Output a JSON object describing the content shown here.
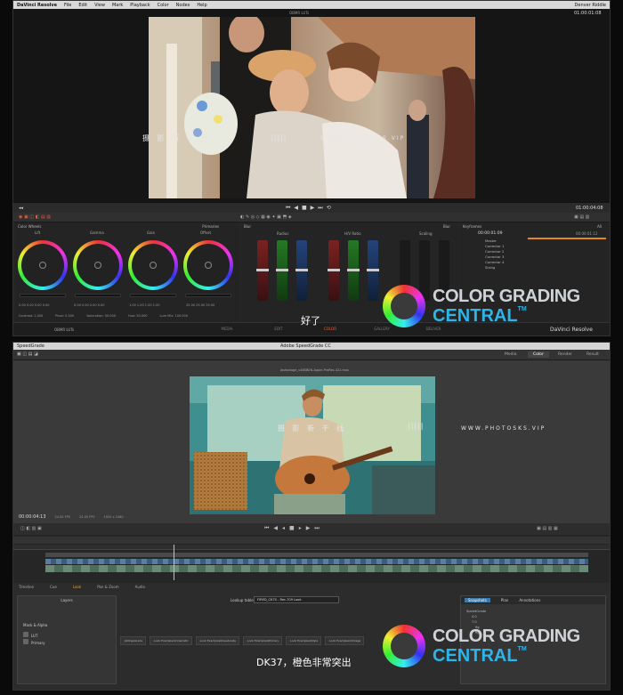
{
  "davinci": {
    "app_name": "DaVinci Resolve",
    "menu": [
      "File",
      "Edit",
      "View",
      "Mark",
      "Playback",
      "Color",
      "Nodes",
      "Help"
    ],
    "user": "Denver Riddle",
    "viewer_title": "OBMR LUTs",
    "timecode_top": "01:00:01:08",
    "timecode_ctrl": "01:00:04:08",
    "wheels_header": "Color Wheels",
    "wheels_mode": "Primaries",
    "wheels": [
      {
        "label": "Lift",
        "vals": "0.00  0.00  0.00  0.00"
      },
      {
        "label": "Gamma",
        "vals": "0.00  0.00  0.00  0.00"
      },
      {
        "label": "Gain",
        "vals": "1.00  1.00  1.00  1.00"
      },
      {
        "label": "Offset",
        "vals": "25.00  25.00  25.00"
      }
    ],
    "wheels_footer": [
      "Contrast: 1.000",
      "Pivot: 0.500",
      "Saturation: 50.000",
      "Hue: 50.000",
      "Lum Mix: 100.000"
    ],
    "curves_sections": [
      "Blur",
      "Radius",
      "H/V Ratio",
      "Scaling"
    ],
    "curves_color": "Blur",
    "nodes_header": "Keyframes",
    "nodes_filter": "All",
    "nodes_timecode": "00:00:01:09",
    "nodes_timecode_right": "00:00:01:12",
    "nodes_list": [
      "Master",
      "Corrector 1",
      "Corrector 2",
      "Corrector 3",
      "Corrector 4",
      "Sizing"
    ],
    "bottom_clip": "OBMR LUTs",
    "bottom_nav": [
      "MEDIA",
      "EDIT",
      "COLOR",
      "GALLERY",
      "DELIVER"
    ],
    "bottom_active": "COLOR",
    "subtitle": "好了"
  },
  "speedgrade": {
    "app_name": "SpeedGrade",
    "title": "Adobe SpeedGrade CC",
    "tabs": [
      "Media",
      "Color",
      "Render",
      "Result"
    ],
    "active_tab": "Color",
    "file_name": "jbsfootage_v4BSBEN-Apple-ProRes-422.mov",
    "timecode": "00:00:04:13",
    "fps": "24.00 FPS",
    "fps2": "24.00 FPS",
    "resolution": "1920 x 1080",
    "lower_tabs": [
      "Timeline",
      "Cue",
      "Look",
      "Pan & Zoom",
      "Audio"
    ],
    "layers_title": "Layers",
    "layer_rows": [
      "Mask & Alpha",
      "LUT",
      "Primary"
    ],
    "lookup_label": "Lookup table",
    "lookup_value": "FIRED_CK70 - Rec.709 Look",
    "look_presets": [
      ".JatIIngsGrade",
      ".Look Examples\\Cinematic",
      ".Look Examples\\Desaturate",
      ".Look Examples\\Primary",
      ".Look Examples\\Style",
      ".Look Examples\\Vintage"
    ],
    "snap_tabs": [
      "Snapshots",
      "Plan",
      "Annotations"
    ],
    "tree": [
      "SpeedGrade",
      "4.0",
      "7.0",
      "fig",
      "fig2"
    ],
    "subtitle": "DK37，橙色非常突出"
  },
  "watermark": {
    "text": "摄 影 新 干 线",
    "url": "WWW.PHOTOSKS.VIP"
  },
  "brand": {
    "line1": "COLOR GRADING",
    "line2": "CENTRAL",
    "tm": "TM"
  }
}
